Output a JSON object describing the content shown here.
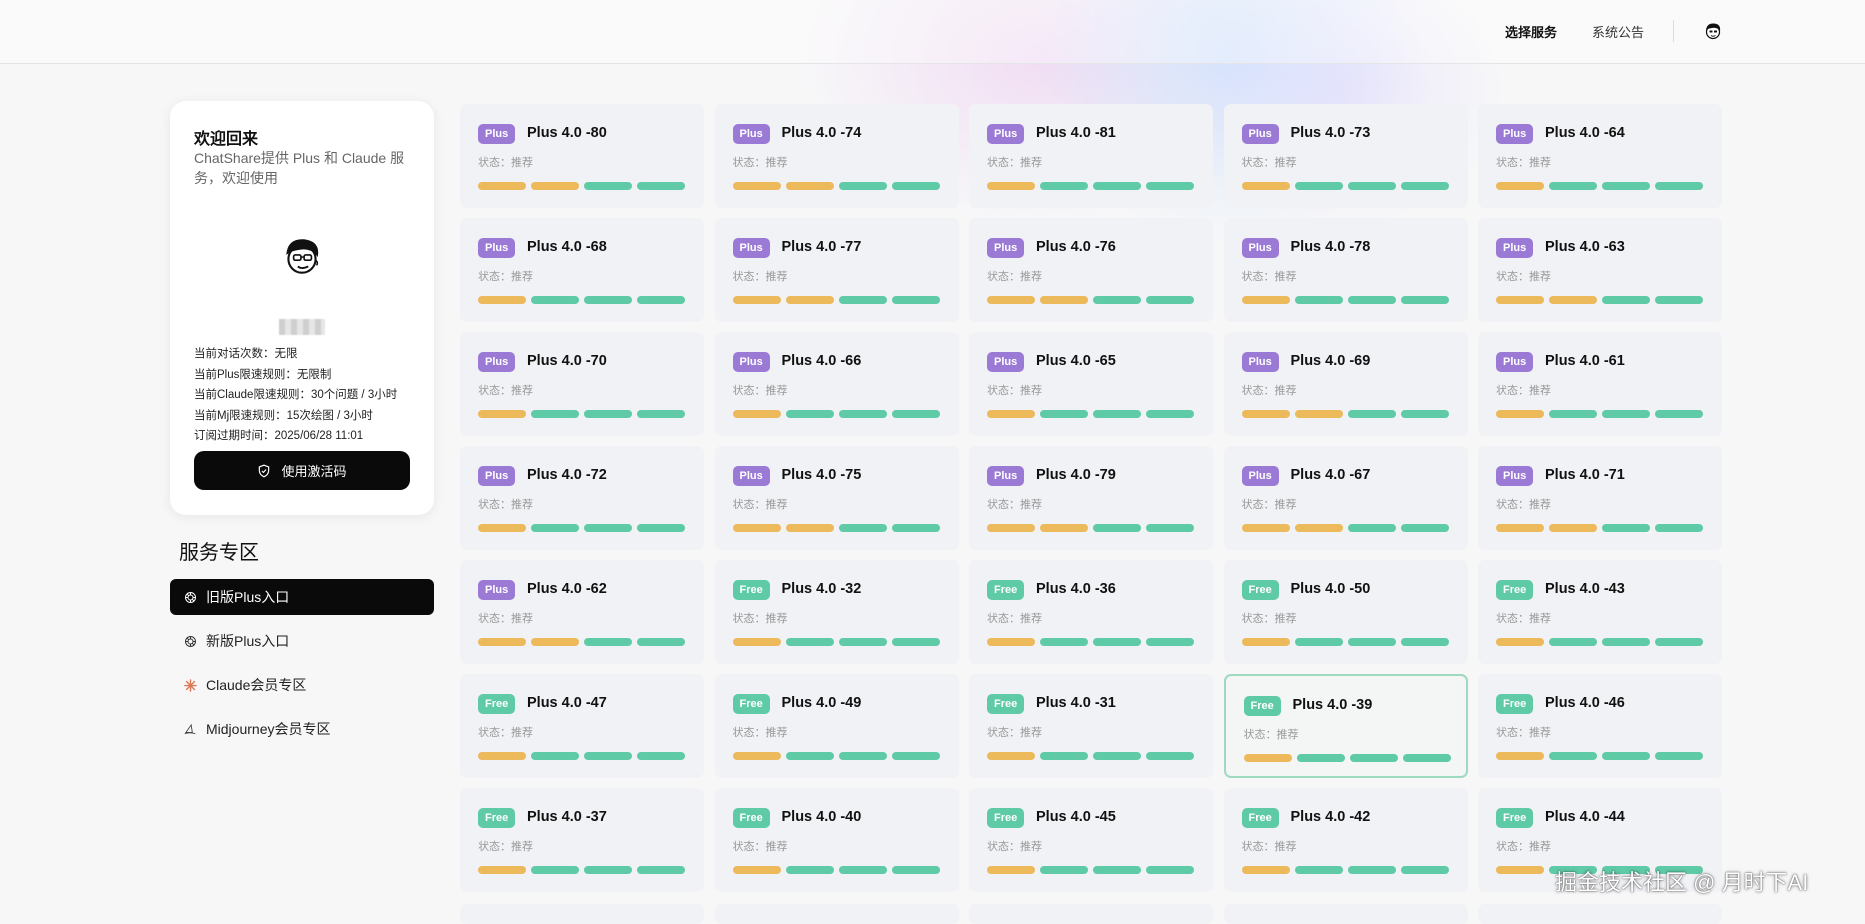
{
  "nav": {
    "select_service": "选择服务",
    "announcement": "系统公告"
  },
  "user_card": {
    "welcome": "欢迎回来",
    "subtitle": "ChatShare提供 Plus 和 Claude 服务，欢迎使用",
    "info": [
      "当前对话次数：无限",
      "当前Plus限速规则：无限制",
      "当前Claude限速规则：30个问题 / 3小时",
      "当前Mj限速规则：15次绘图 / 3小时",
      "订阅过期时间：2025/06/28 11:01"
    ],
    "activate_label": "使用激活码"
  },
  "section": {
    "title": "服务专区",
    "menu": [
      {
        "label": "旧版Plus入口",
        "icon": "openai-icon",
        "active": true
      },
      {
        "label": "新版Plus入口",
        "icon": "openai-icon",
        "active": false
      },
      {
        "label": "Claude会员专区",
        "icon": "claude-icon",
        "active": false
      },
      {
        "label": "Midjourney会员专区",
        "icon": "midjourney-icon",
        "active": false
      }
    ]
  },
  "status_label": "状态：推荐",
  "cards": [
    {
      "tier": "Plus",
      "name": "Plus 4.0 -80",
      "bars": "yygg"
    },
    {
      "tier": "Plus",
      "name": "Plus 4.0 -74",
      "bars": "yygg"
    },
    {
      "tier": "Plus",
      "name": "Plus 4.0 -81",
      "bars": "yggg"
    },
    {
      "tier": "Plus",
      "name": "Plus 4.0 -73",
      "bars": "yggg"
    },
    {
      "tier": "Plus",
      "name": "Plus 4.0 -64",
      "bars": "yggg"
    },
    {
      "tier": "Plus",
      "name": "Plus 4.0 -68",
      "bars": "yggg"
    },
    {
      "tier": "Plus",
      "name": "Plus 4.0 -77",
      "bars": "yygg"
    },
    {
      "tier": "Plus",
      "name": "Plus 4.0 -76",
      "bars": "yygg"
    },
    {
      "tier": "Plus",
      "name": "Plus 4.0 -78",
      "bars": "yggg"
    },
    {
      "tier": "Plus",
      "name": "Plus 4.0 -63",
      "bars": "yygg"
    },
    {
      "tier": "Plus",
      "name": "Plus 4.0 -70",
      "bars": "yggg"
    },
    {
      "tier": "Plus",
      "name": "Plus 4.0 -66",
      "bars": "yggg"
    },
    {
      "tier": "Plus",
      "name": "Plus 4.0 -65",
      "bars": "yggg"
    },
    {
      "tier": "Plus",
      "name": "Plus 4.0 -69",
      "bars": "yygg"
    },
    {
      "tier": "Plus",
      "name": "Plus 4.0 -61",
      "bars": "yggg"
    },
    {
      "tier": "Plus",
      "name": "Plus 4.0 -72",
      "bars": "yggg"
    },
    {
      "tier": "Plus",
      "name": "Plus 4.0 -75",
      "bars": "yygg"
    },
    {
      "tier": "Plus",
      "name": "Plus 4.0 -79",
      "bars": "yygg"
    },
    {
      "tier": "Plus",
      "name": "Plus 4.0 -67",
      "bars": "yygg"
    },
    {
      "tier": "Plus",
      "name": "Plus 4.0 -71",
      "bars": "yygg"
    },
    {
      "tier": "Plus",
      "name": "Plus 4.0 -62",
      "bars": "yygg"
    },
    {
      "tier": "Free",
      "name": "Plus 4.0 -32",
      "bars": "yggg"
    },
    {
      "tier": "Free",
      "name": "Plus 4.0 -36",
      "bars": "yggg"
    },
    {
      "tier": "Free",
      "name": "Plus 4.0 -50",
      "bars": "yggg"
    },
    {
      "tier": "Free",
      "name": "Plus 4.0 -43",
      "bars": "yggg"
    },
    {
      "tier": "Free",
      "name": "Plus 4.0 -47",
      "bars": "yggg"
    },
    {
      "tier": "Free",
      "name": "Plus 4.0 -49",
      "bars": "yggg"
    },
    {
      "tier": "Free",
      "name": "Plus 4.0 -31",
      "bars": "yggg"
    },
    {
      "tier": "Free",
      "name": "Plus 4.0 -39",
      "bars": "yggg",
      "selected": true
    },
    {
      "tier": "Free",
      "name": "Plus 4.0 -46",
      "bars": "yggg"
    },
    {
      "tier": "Free",
      "name": "Plus 4.0 -37",
      "bars": "yggg"
    },
    {
      "tier": "Free",
      "name": "Plus 4.0 -40",
      "bars": "yggg"
    },
    {
      "tier": "Free",
      "name": "Plus 4.0 -45",
      "bars": "yggg"
    },
    {
      "tier": "Free",
      "name": "Plus 4.0 -42",
      "bars": "yggg"
    },
    {
      "tier": "Free",
      "name": "Plus 4.0 -44",
      "bars": "yggg"
    }
  ],
  "colors": {
    "plus_badge": "#9b7ad6",
    "free_badge": "#5fcaa6",
    "bar_yellow": "#ecb95b",
    "bar_green": "#5fcaa6",
    "dark_button": "#0a0a0a"
  },
  "watermark": "掘金技术社区 @ 月时下AI"
}
